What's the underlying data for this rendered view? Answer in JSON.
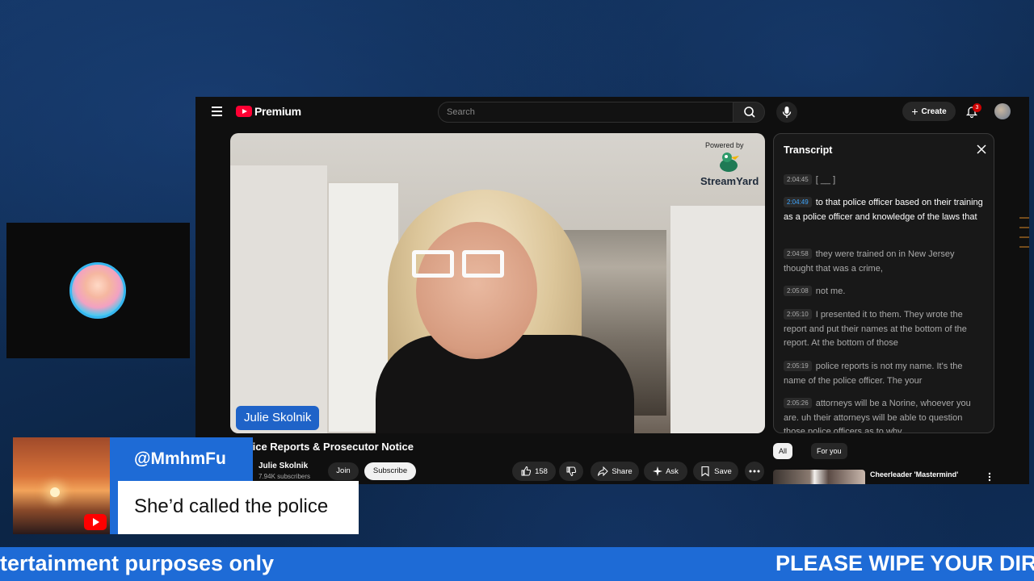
{
  "youtube": {
    "logo_text": "Premium",
    "search_placeholder": "Search",
    "create_label": "Create",
    "notification_count": "3",
    "video": {
      "powered_by": "Powered by",
      "streamyard": "StreamYard",
      "name_tag": "Julie Skolnik"
    },
    "title": "lice Reports & Prosecutor Notice",
    "channel": {
      "name": "Julie Skolnik",
      "subscribers": "7.94K subscribers",
      "join_label": "Join",
      "subscribe_label": "Subscribe"
    },
    "actions": {
      "likes": "158",
      "share": "Share",
      "ask": "Ask",
      "save": "Save"
    },
    "transcript": {
      "title": "Transcript",
      "segments": [
        {
          "time": "2:04:45",
          "text": "[ __ ]"
        },
        {
          "time": "2:04:49",
          "text": "to that police officer based on their training as a police officer and knowledge of the laws that"
        },
        {
          "time": "2:04:58",
          "text": "they were trained on in New Jersey thought that was a crime,"
        },
        {
          "time": "2:05:08",
          "text": "not me."
        },
        {
          "time": "2:05:10",
          "text": "I presented it to them. They wrote the report and put their names at the bottom of the report. At the bottom of those"
        },
        {
          "time": "2:05:19",
          "text": "police reports is not my name. It's the name of the police officer. The your"
        },
        {
          "time": "2:05:26",
          "text": "attorneys will be a Norine, whoever you are. uh their attorneys will be able to question those police officers as to why"
        }
      ],
      "active_index": 1
    },
    "chips": {
      "all": "All",
      "for_you": "For you"
    },
    "recommendation": {
      "title": "Cheerleader 'Mastermind'"
    }
  },
  "chat": {
    "username": "@MmhmFu",
    "message": "She’d called the police"
  },
  "ticker": {
    "left_text": "tertainment purposes only",
    "right_text": "PLEASE WIPE YOUR DIRT"
  },
  "colors": {
    "background": "#0e2a50",
    "accent_blue": "#1e6bd6",
    "yt_red": "#ff0033"
  }
}
